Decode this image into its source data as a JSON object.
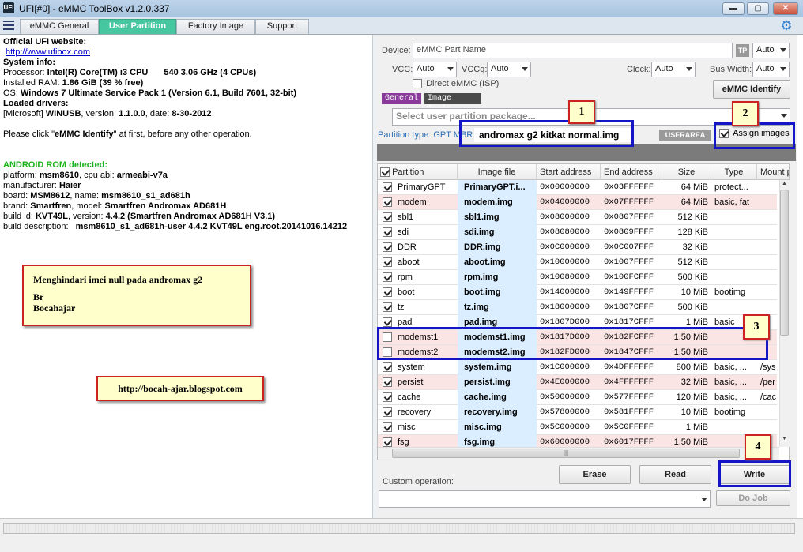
{
  "window": {
    "title": "UFI[#0] - eMMC ToolBox v1.2.0.337",
    "app_icon": "UFI",
    "minimize": "▬",
    "maximize": "▢",
    "close": "✕"
  },
  "tabs": [
    {
      "label": "eMMC General"
    },
    {
      "label": "User Partition"
    },
    {
      "label": "Factory Image"
    },
    {
      "label": "Support"
    }
  ],
  "info": {
    "website_label": "Official UFI website:",
    "website_url": "http://www.ufibox.com",
    "sysinfo_label": "System info:",
    "processor_label": "Processor:",
    "processor_value": "Intel(R) Core(TM) i3 CPU",
    "processor_speed": "540 3.06 GHz (4 CPUs)",
    "ram_label": "Installed RAM:",
    "ram_value": "1.86 GiB (39 % free)",
    "os_label": "OS:",
    "os_value": "Windows 7 Ultimate Service Pack 1 (Version 6.1, Build 7601, 32-bit)",
    "drivers_label": "Loaded drivers:",
    "driver_prefix": "[Microsoft]",
    "driver_name": "WINUSB",
    "driver_version_label": ", version:",
    "driver_version": "1.1.0.0",
    "driver_date_label": ", date:",
    "driver_date": "8-30-2012",
    "hint_pre": "Please click \"",
    "hint_bold": "eMMC Identify",
    "hint_post": "\" at first, before any other operation.",
    "rom_detected": "ANDROID ROM detected:",
    "platform_label": "platform:",
    "platform_value": "msm8610",
    "cpu_label": ", cpu abi:",
    "cpu_value": "armeabi-v7a",
    "manufacturer_label": "manufacturer:",
    "manufacturer_value": "Haier",
    "board_label": "board:",
    "board_value": "MSM8612",
    "name_label": ", name:",
    "name_value": "msm8610_s1_ad681h",
    "brand_label": "brand:",
    "brand_value": "Smartfren",
    "model_label": ", model:",
    "model_value": "Smartfren Andromax AD681H",
    "buildid_label": "build id:",
    "buildid_value": "KVT49L",
    "version_label": ", version:",
    "version_value": "4.4.2 (Smartfren Andromax AD681H V3.1)",
    "builddesc_label": "build description:",
    "builddesc_value": "msm8610_s1_ad681h-user 4.4.2 KVT49L eng.root.20141016.14212"
  },
  "note": {
    "line1": "Menghindari imei null pada andromax g2",
    "line2": "Br",
    "line3": "Bocahajar"
  },
  "blog": "http://bocah-ajar.blogspot.com",
  "device": {
    "device_label": "Device:",
    "device_placeholder": "eMMC Part Name",
    "tp_label": "TP",
    "tp_value": "Auto",
    "vcc_label": "VCC:",
    "vcc_value": "Auto",
    "vccq_label": "VCCq:",
    "vccq_value": "Auto",
    "clock_label": "Clock:",
    "clock_value": "Auto",
    "buswidth_label": "Bus Width:",
    "buswidth_value": "Auto",
    "direct_label": "Direct eMMC (ISP)",
    "identify_button": "eMMC Identify"
  },
  "mini_tabs": [
    "General",
    "Image Tools"
  ],
  "package_placeholder": "Select user partition package...",
  "partition_type": "Partition type: GPT MBR",
  "image_name": "andromax g2 kitkat normal.img",
  "userarea": "USERAREA",
  "assign_images": "Assign images",
  "columns": [
    "Partition",
    "Image file",
    "Start address",
    "End address",
    "Size",
    "Type",
    "Mount p"
  ],
  "rows": [
    {
      "checked": true,
      "partition": "PrimaryGPT",
      "image": "PrimaryGPT.i...",
      "start": "0x00000000",
      "end": "0x03FFFFFF",
      "size": "64 MiB",
      "type": "protect...",
      "mount": "",
      "pink": false
    },
    {
      "checked": true,
      "partition": "modem",
      "image": "modem.img",
      "start": "0x04000000",
      "end": "0x07FFFFFF",
      "size": "64 MiB",
      "type": "basic, fat",
      "mount": "",
      "pink": true
    },
    {
      "checked": true,
      "partition": "sbl1",
      "image": "sbl1.img",
      "start": "0x08000000",
      "end": "0x0807FFFF",
      "size": "512 KiB",
      "type": "",
      "mount": "",
      "pink": false
    },
    {
      "checked": true,
      "partition": "sdi",
      "image": "sdi.img",
      "start": "0x08080000",
      "end": "0x0809FFFF",
      "size": "128 KiB",
      "type": "",
      "mount": "",
      "pink": false
    },
    {
      "checked": true,
      "partition": "DDR",
      "image": "DDR.img",
      "start": "0x0C000000",
      "end": "0x0C007FFF",
      "size": "32 KiB",
      "type": "",
      "mount": "",
      "pink": false
    },
    {
      "checked": true,
      "partition": "aboot",
      "image": "aboot.img",
      "start": "0x10000000",
      "end": "0x1007FFFF",
      "size": "512 KiB",
      "type": "",
      "mount": "",
      "pink": false
    },
    {
      "checked": true,
      "partition": "rpm",
      "image": "rpm.img",
      "start": "0x10080000",
      "end": "0x100FCFFF",
      "size": "500 KiB",
      "type": "",
      "mount": "",
      "pink": false
    },
    {
      "checked": true,
      "partition": "boot",
      "image": "boot.img",
      "start": "0x14000000",
      "end": "0x149FFFFF",
      "size": "10 MiB",
      "type": "bootimg",
      "mount": "",
      "pink": false
    },
    {
      "checked": true,
      "partition": "tz",
      "image": "tz.img",
      "start": "0x18000000",
      "end": "0x1807CFFF",
      "size": "500 KiB",
      "type": "",
      "mount": "",
      "pink": false
    },
    {
      "checked": true,
      "partition": "pad",
      "image": "pad.img",
      "start": "0x1807D000",
      "end": "0x1817CFFF",
      "size": "1 MiB",
      "type": "basic",
      "mount": "",
      "pink": false
    },
    {
      "checked": false,
      "partition": "modemst1",
      "image": "modemst1.img",
      "start": "0x1817D000",
      "end": "0x182FCFFF",
      "size": "1.50 MiB",
      "type": "",
      "mount": "",
      "pink": true
    },
    {
      "checked": false,
      "partition": "modemst2",
      "image": "modemst2.img",
      "start": "0x182FD000",
      "end": "0x1847CFFF",
      "size": "1.50 MiB",
      "type": "",
      "mount": "",
      "pink": true
    },
    {
      "checked": true,
      "partition": "system",
      "image": "system.img",
      "start": "0x1C000000",
      "end": "0x4DFFFFFF",
      "size": "800 MiB",
      "type": "basic, ...",
      "mount": "/sys",
      "pink": false
    },
    {
      "checked": true,
      "partition": "persist",
      "image": "persist.img",
      "start": "0x4E000000",
      "end": "0x4FFFFFFF",
      "size": "32 MiB",
      "type": "basic, ...",
      "mount": "/per",
      "pink": true
    },
    {
      "checked": true,
      "partition": "cache",
      "image": "cache.img",
      "start": "0x50000000",
      "end": "0x577FFFFF",
      "size": "120 MiB",
      "type": "basic, ...",
      "mount": "/cac",
      "pink": false
    },
    {
      "checked": true,
      "partition": "recovery",
      "image": "recovery.img",
      "start": "0x57800000",
      "end": "0x581FFFFF",
      "size": "10 MiB",
      "type": "bootimg",
      "mount": "",
      "pink": false
    },
    {
      "checked": true,
      "partition": "misc",
      "image": "misc.img",
      "start": "0x5C000000",
      "end": "0x5C0FFFFF",
      "size": "1 MiB",
      "type": "",
      "mount": "",
      "pink": false
    },
    {
      "checked": true,
      "partition": "fsg",
      "image": "fsg.img",
      "start": "0x60000000",
      "end": "0x6017FFFF",
      "size": "1.50 MiB",
      "type": "",
      "mount": "",
      "pink": true
    }
  ],
  "actions": {
    "erase": "Erase",
    "read": "Read",
    "write": "Write",
    "dojob": "Do Job"
  },
  "custom_operation_label": "Custom operation:",
  "annotations": [
    "1",
    "2",
    "3",
    "4"
  ],
  "hscroll_grip": "|||",
  "icons": {
    "menu": "hamburger-icon",
    "gear": "gear-icon",
    "dropdown": "chevron-down-icon"
  },
  "colors": {
    "active_tab": "#47c7a0",
    "annotation_border": "#1515c8",
    "callout_border": "#cc2222",
    "callout_fill": "#ffffcc",
    "rom_text": "#1db31d"
  }
}
